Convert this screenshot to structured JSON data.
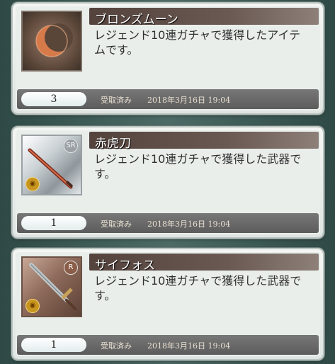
{
  "items": [
    {
      "name": "ブロンズムーン",
      "description": "レジェンド10連ガチャで獲得したアイテムです。",
      "quantity": "3",
      "status": "受取済み",
      "date": "2018年3月16日 19:04",
      "icon": "bronze-moon-icon",
      "rarity": "",
      "element": ""
    },
    {
      "name": "赤虎刀",
      "description": "レジェンド10連ガチャで獲得した武器です。",
      "quantity": "1",
      "status": "受取済み",
      "date": "2018年3月16日 19:04",
      "icon": "red-katana-icon",
      "rarity": "SR",
      "element": "fire"
    },
    {
      "name": "サイフォス",
      "description": "レジェンド10連ガチャで獲得した武器です。",
      "quantity": "1",
      "status": "受取済み",
      "date": "2018年3月16日 19:04",
      "icon": "xiphos-sword-icon",
      "rarity": "R",
      "element": "fire"
    }
  ]
}
